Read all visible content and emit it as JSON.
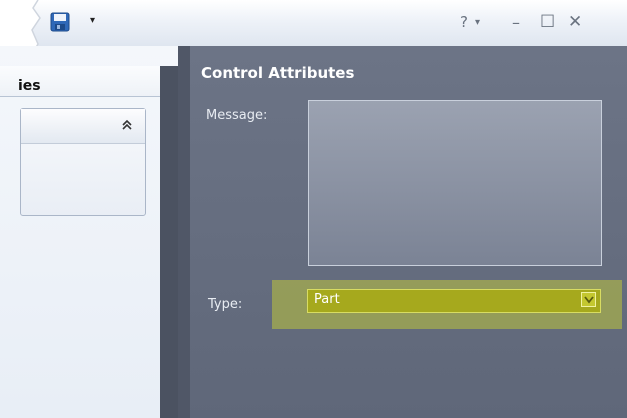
{
  "titlebar": {
    "help_glyph": "?",
    "caret_glyph": "▾",
    "minimize_glyph": "–",
    "maximize_glyph": "☐",
    "close_glyph": "✕",
    "icons": {
      "save": "save-icon",
      "collapse": "double-chevron-up-icon",
      "dropdown": "chevron-down-icon"
    }
  },
  "left_panel": {
    "header_text": "ies",
    "collapse_glyph": "≈"
  },
  "control_attributes": {
    "title": "Control Attributes",
    "message_label": "Message:",
    "message_value": "",
    "type_label": "Type:",
    "type_value": "Part"
  },
  "colors": {
    "panel_bg": "#666d80",
    "highlight": "#bec43c",
    "select_bg": "#a6a91d"
  }
}
